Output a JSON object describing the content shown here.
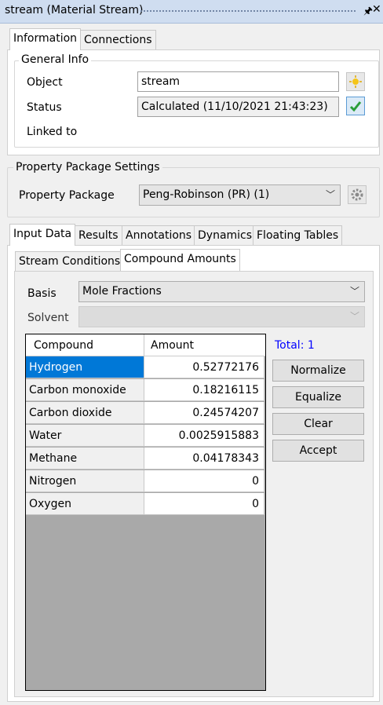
{
  "window": {
    "title": "stream (Material Stream)",
    "pin_icon": "pin-icon",
    "close_icon": "close-icon"
  },
  "top_tabs": [
    "Information",
    "Connections"
  ],
  "general_info": {
    "legend": "General Info",
    "object_label": "Object",
    "object_value": "stream",
    "status_label": "Status",
    "status_value": "Calculated (11/10/2021 21:43:23)",
    "linked_label": "Linked to"
  },
  "property_package": {
    "legend": "Property Package Settings",
    "label": "Property Package",
    "value": "Peng-Robinson (PR) (1)"
  },
  "main_tabs": [
    "Input Data",
    "Results",
    "Annotations",
    "Dynamics",
    "Floating Tables"
  ],
  "sub_tabs": [
    "Stream Conditions",
    "Compound Amounts"
  ],
  "basis": {
    "label": "Basis",
    "value": "Mole Fractions"
  },
  "solvent": {
    "label": "Solvent",
    "value": ""
  },
  "table": {
    "headers": [
      "Compound",
      "Amount"
    ],
    "rows": [
      {
        "name": "Hydrogen",
        "amount": "0.52772176"
      },
      {
        "name": "Carbon monoxide",
        "amount": "0.18216115"
      },
      {
        "name": "Carbon dioxide",
        "amount": "0.24574207"
      },
      {
        "name": "Water",
        "amount": "0.0025915883"
      },
      {
        "name": "Methane",
        "amount": "0.04178343"
      },
      {
        "name": "Nitrogen",
        "amount": "0"
      },
      {
        "name": "Oxygen",
        "amount": "0"
      }
    ]
  },
  "total": {
    "text": "Total: 1",
    "color": "#0000ff"
  },
  "buttons": {
    "normalize": "Normalize",
    "equalize": "Equalize",
    "clear": "Clear",
    "accept": "Accept"
  },
  "colors": {
    "selection": "#0078d7",
    "titlebar": "#cfddf0",
    "check": "#2a9d3a"
  }
}
